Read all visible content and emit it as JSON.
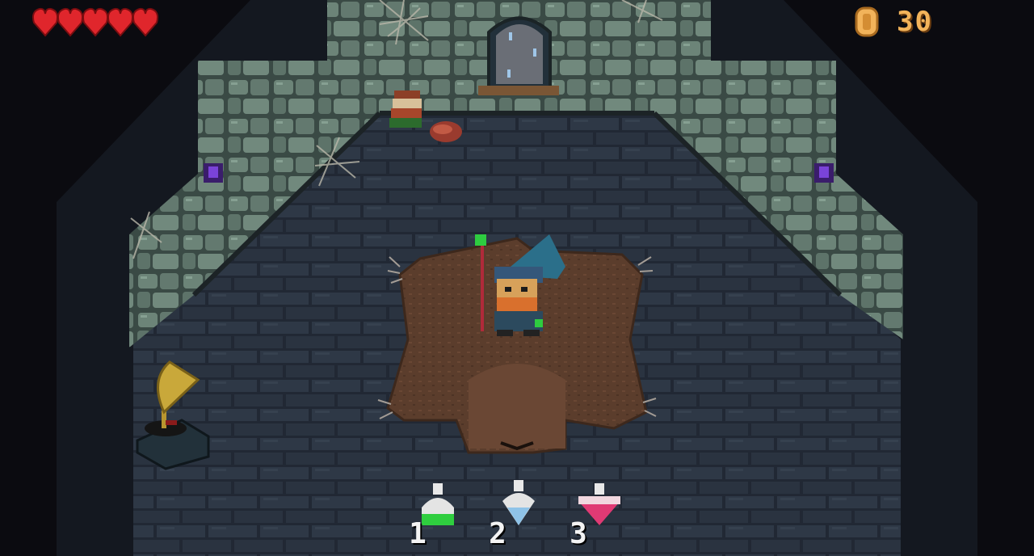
{
  "hud": {
    "hearts": {
      "filled": 5,
      "total": 5,
      "color": "#e0262c"
    },
    "coin_icon": "gold-coin-icon",
    "coin_count": "30"
  },
  "room": {
    "floor_color": "#2c3542",
    "wall_color": "#6b8277",
    "rug": "bear-skin-rug",
    "props": [
      "gramophone",
      "book-stack",
      "raw-meat",
      "arched-window",
      "cobwebs",
      "purple-wall-gems"
    ]
  },
  "player": {
    "character": "wizard",
    "staff_gem_color": "#2ecc40"
  },
  "potion_bar": {
    "slots": [
      {
        "key": "1",
        "potion": "green-potion-icon",
        "color": "#2fce3f"
      },
      {
        "key": "2",
        "potion": "blue-potion-icon",
        "color": "#8fc3e8"
      },
      {
        "key": "3",
        "potion": "pink-potion-icon",
        "color": "#e03a74"
      }
    ]
  }
}
